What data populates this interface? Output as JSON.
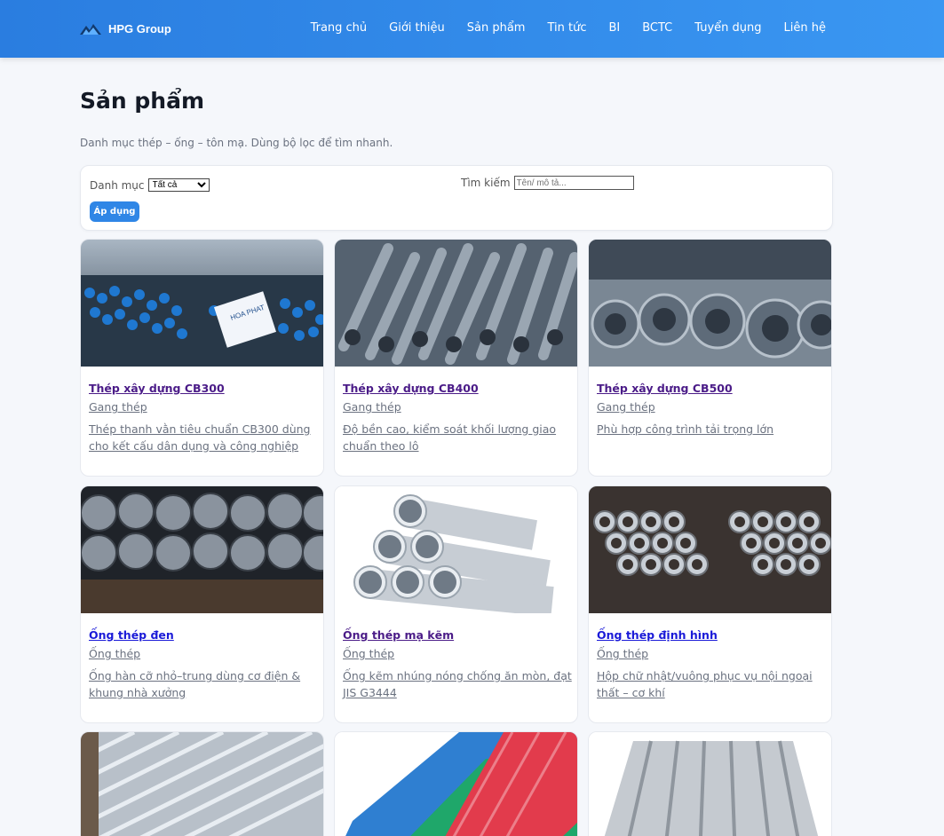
{
  "header": {
    "brand": "HPG Group",
    "nav": [
      "Trang chủ",
      "Giới thiệu",
      "Sản phẩm",
      "Tin tức",
      "BI",
      "BCTC",
      "Tuyển dụng",
      "Liên hệ"
    ]
  },
  "page": {
    "title": "Sản phẩm",
    "description": "Danh mục thép – ống – tôn mạ. Dùng bộ lọc để tìm nhanh."
  },
  "filter": {
    "category_label": "Danh mục",
    "category_selected": "Tất cả",
    "search_label": "Tìm kiếm",
    "search_placeholder": "Tên/ mô tả...",
    "apply_label": "Áp dụng"
  },
  "products": [
    {
      "title": "Thép xây dựng CB300",
      "category": "Gang thép",
      "description": "Thép thanh vằn tiêu chuẩn CB300 dùng cho kết cấu dân dụng và công nghiệp",
      "image": "rebar-bundle-blue-caps"
    },
    {
      "title": "Thép xây dựng CB400",
      "category": "Gang thép",
      "description": "Độ bền cao, kiểm soát khối lượng giao chuẩn theo lô",
      "image": "rebar-closeup"
    },
    {
      "title": "Thép xây dựng CB500",
      "category": "Gang thép",
      "description": "Phù hợp công trình tải trọng lớn",
      "image": "wire-coils"
    },
    {
      "title": "Ống thép đen",
      "category": "Ống thép",
      "description": "Ống hàn cỡ nhỏ–trung dùng cơ điện & khung nhà xưởng",
      "image": "black-pipes-stack"
    },
    {
      "title": "Ống thép mạ kẽm",
      "category": "Ống thép",
      "description": "Ống kẽm nhúng nóng chống ăn mòn, đạt JIS G3444",
      "image": "galvanized-pipes"
    },
    {
      "title": "Ống thép định hình",
      "category": "Ống thép",
      "description": "Hộp chữ nhật/vuông phục vụ nội ngoại thất – cơ khí",
      "image": "steel-tubes-stack"
    },
    {
      "title": "",
      "category": "",
      "description": "",
      "image": "corrugated-silver-sheet"
    },
    {
      "title": "",
      "category": "",
      "description": "",
      "image": "colored-roofing-sheets"
    },
    {
      "title": "",
      "category": "",
      "description": "",
      "image": "trapezoid-roofing-sheet"
    }
  ]
}
